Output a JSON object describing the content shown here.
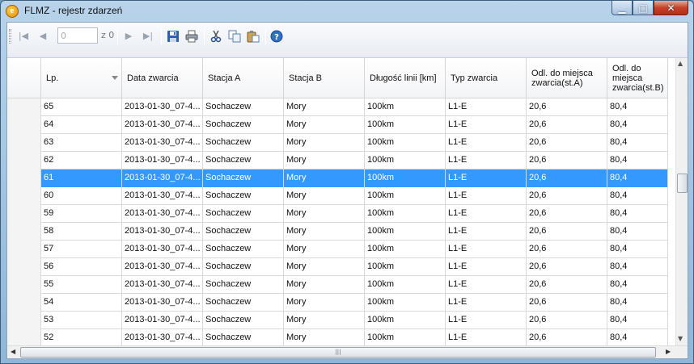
{
  "window": {
    "title": "FLMZ - rejestr zdarzeń",
    "app_icon_glyph": "e",
    "min_glyph": "▁",
    "max_glyph": "□",
    "close_glyph": "✕"
  },
  "toolbar": {
    "first_glyph": "|◀",
    "prev_glyph": "◀",
    "position_value": "0",
    "of_label": "z 0",
    "next_glyph": "▶",
    "last_glyph": "▶|",
    "save_icon": "save-icon",
    "print_icon": "printer-icon",
    "cut_icon": "scissors-icon",
    "copy_icon": "copy-icon",
    "paste_icon": "paste-icon",
    "help_icon": "help-icon"
  },
  "table": {
    "columns": [
      "Lp.",
      "Data zwarcia",
      "Stacja A",
      "Stacja B",
      "Długość linii [km]",
      "Typ zwarcia",
      "Odl. do miejsca zwarcia(st.A)",
      "Odl. do miejsca zwarcia(st.B)"
    ],
    "rows": [
      [
        "65",
        "2013-01-30_07-4...",
        "Sochaczew",
        "Mory",
        "100km",
        "L1-E",
        "20,6",
        "80,4"
      ],
      [
        "64",
        "2013-01-30_07-4...",
        "Sochaczew",
        "Mory",
        "100km",
        "L1-E",
        "20,6",
        "80,4"
      ],
      [
        "63",
        "2013-01-30_07-4...",
        "Sochaczew",
        "Mory",
        "100km",
        "L1-E",
        "20,6",
        "80,4"
      ],
      [
        "62",
        "2013-01-30_07-4...",
        "Sochaczew",
        "Mory",
        "100km",
        "L1-E",
        "20,6",
        "80,4"
      ],
      [
        "61",
        "2013-01-30_07-4...",
        "Sochaczew",
        "Mory",
        "100km",
        "L1-E",
        "20,6",
        "80,4"
      ],
      [
        "60",
        "2013-01-30_07-4...",
        "Sochaczew",
        "Mory",
        "100km",
        "L1-E",
        "20,6",
        "80,4"
      ],
      [
        "59",
        "2013-01-30_07-4...",
        "Sochaczew",
        "Mory",
        "100km",
        "L1-E",
        "20,6",
        "80,4"
      ],
      [
        "58",
        "2013-01-30_07-4...",
        "Sochaczew",
        "Mory",
        "100km",
        "L1-E",
        "20,6",
        "80,4"
      ],
      [
        "57",
        "2013-01-30_07-4...",
        "Sochaczew",
        "Mory",
        "100km",
        "L1-E",
        "20,6",
        "80,4"
      ],
      [
        "56",
        "2013-01-30_07-4...",
        "Sochaczew",
        "Mory",
        "100km",
        "L1-E",
        "20,6",
        "80,4"
      ],
      [
        "55",
        "2013-01-30_07-4...",
        "Sochaczew",
        "Mory",
        "100km",
        "L1-E",
        "20,6",
        "80,4"
      ],
      [
        "54",
        "2013-01-30_07-4...",
        "Sochaczew",
        "Mory",
        "100km",
        "L1-E",
        "20,6",
        "80,4"
      ],
      [
        "53",
        "2013-01-30_07-4...",
        "Sochaczew",
        "Mory",
        "100km",
        "L1-E",
        "20,6",
        "80,4"
      ],
      [
        "52",
        "2013-01-30_07-4...",
        "Sochaczew",
        "Mory",
        "100km",
        "L1-E",
        "20,6",
        "80,4"
      ]
    ],
    "selected_row_index": 4,
    "selection_color": "#3399ff"
  },
  "scrollbars": {
    "h_grip": "|||",
    "left_arrow": "◀",
    "right_arrow": "▶",
    "up_arrow": "▲",
    "down_arrow": "▼"
  }
}
